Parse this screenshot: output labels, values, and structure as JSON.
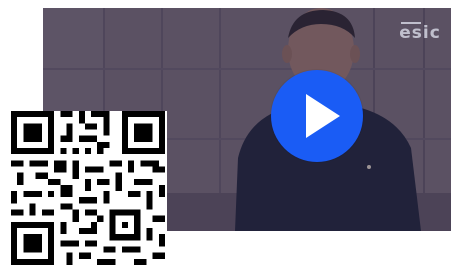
{
  "video": {
    "brand_logo_text": "esic",
    "play_icon": "play-icon",
    "accent_color": "#1a5cf5"
  },
  "qr": {
    "icon": "qr-code-icon"
  }
}
